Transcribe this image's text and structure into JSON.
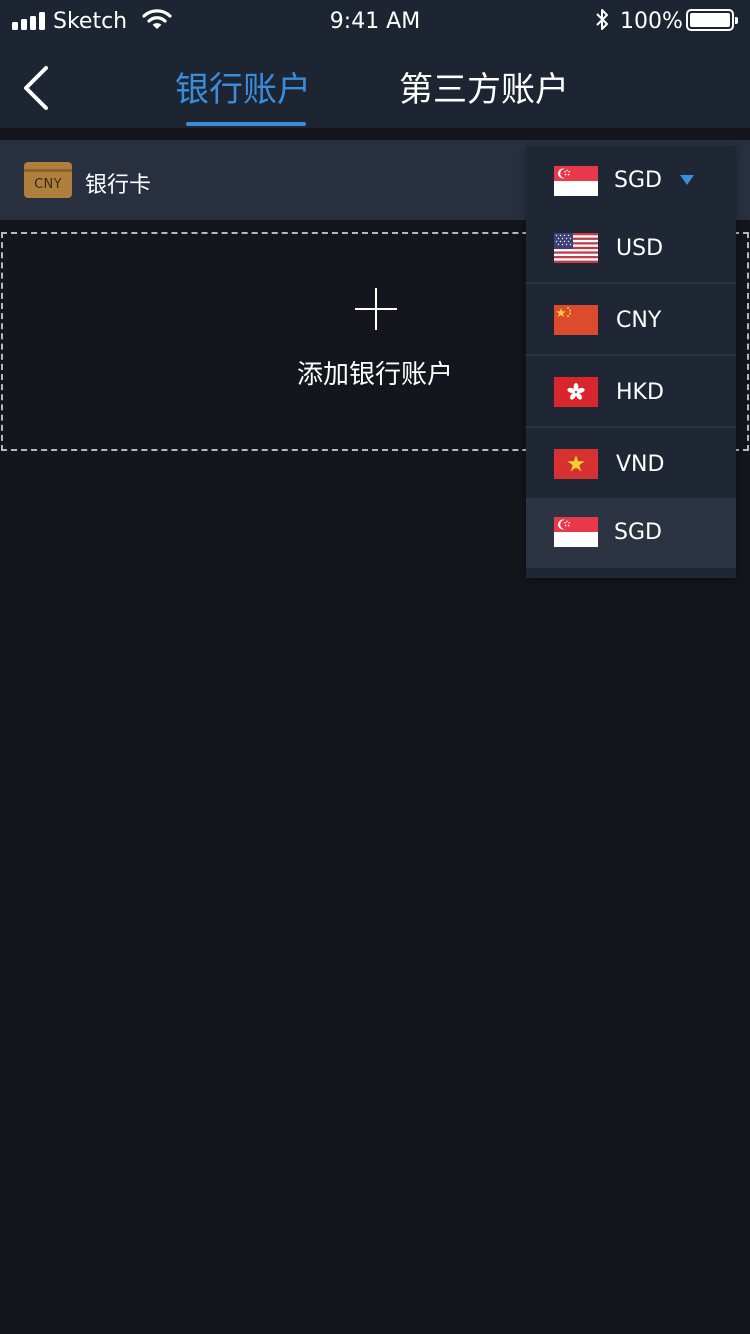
{
  "status_bar": {
    "carrier": "Sketch",
    "time": "9:41 AM",
    "battery_percent": "100%",
    "battery_level": 1.0
  },
  "nav": {
    "back_icon": "chevron-left-icon",
    "tabs": [
      {
        "label": "银行账户",
        "active": true
      },
      {
        "label": "第三方账户",
        "active": false
      }
    ],
    "active_color": "#3a8ddd"
  },
  "bank_card_row": {
    "card_code": "CNY",
    "label": "银行卡"
  },
  "add_account": {
    "icon": "plus-icon",
    "label": "添加银行账户"
  },
  "currency_dropdown": {
    "selected": "SGD",
    "options": [
      {
        "code": "USD",
        "flag": "us-flag-icon"
      },
      {
        "code": "CNY",
        "flag": "cn-flag-icon"
      },
      {
        "code": "HKD",
        "flag": "hk-flag-icon"
      },
      {
        "code": "VND",
        "flag": "vn-flag-icon"
      },
      {
        "code": "SGD",
        "flag": "sg-flag-icon",
        "selected": true
      }
    ]
  },
  "colors": {
    "background": "#14151d",
    "header": "#1e2532",
    "card_row": "#283040",
    "accent": "#3a8ddd",
    "card_icon": "#b07f3c"
  }
}
